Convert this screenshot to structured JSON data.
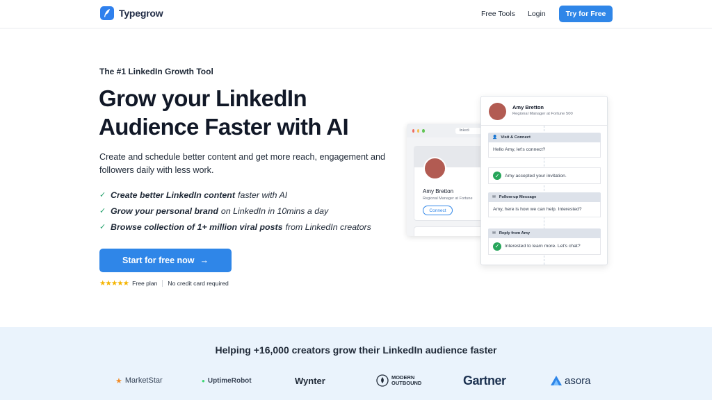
{
  "header": {
    "brand": "Typegrow",
    "nav": {
      "free_tools": "Free Tools",
      "login": "Login"
    },
    "cta": "Try for Free"
  },
  "hero": {
    "eyebrow": "The #1 LinkedIn Growth Tool",
    "headline": "Grow your LinkedIn Audience Faster with AI",
    "subtext": "Create and schedule better content and get more reach, engagement and followers daily with less work.",
    "features": [
      {
        "bold": "Create better LinkedIn content",
        "rest": "faster with AI"
      },
      {
        "bold": "Grow your personal brand",
        "rest": "on LinkedIn in 10mins a day"
      },
      {
        "bold": "Browse collection of 1+ million viral posts",
        "rest": "from LinkedIn creators"
      }
    ],
    "cta": "Start for free now",
    "trust": {
      "plan": "Free plan",
      "card": "No credit card required"
    }
  },
  "mockup": {
    "browser_url": "linkedi",
    "profile": {
      "name": "Amy Bretton",
      "role": "Regional Manager at Fortune",
      "connect": "Connect"
    },
    "sequence": {
      "name": "Amy Bretton",
      "role": "Regional Manager at Fortune 500",
      "steps": [
        {
          "label": "Visit & Connect",
          "body": "Hello Amy, let's connect?"
        },
        {
          "body": "Amy accepted your invitation."
        },
        {
          "label": "Follow-up Message",
          "body": "Amy, here is how we can help. Interested?"
        },
        {
          "label": "Reply from Amy",
          "body": "Interested to learn more. Let's chat?"
        }
      ]
    }
  },
  "social_proof": {
    "title": "Helping +16,000 creators grow their LinkedIn audience faster",
    "logos": [
      "MarketStar",
      "UptimeRobot",
      "Wynter",
      "MODERN",
      "OUTBOUND",
      "Gartner",
      "asora"
    ]
  },
  "colors": {
    "primary": "#2f86e8",
    "band": "#eaf3fc",
    "check": "#22a06b",
    "stars": "#f5b400"
  }
}
